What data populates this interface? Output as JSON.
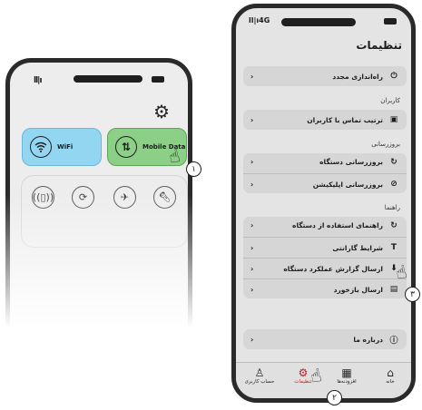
{
  "left_phone": {
    "tiles": {
      "wifi_label": "WiFi",
      "mobile_label": "Mobile Data"
    },
    "quick_buttons": [
      "vibrate-icon",
      "rotate-icon",
      "airplane-icon",
      "flashlight-icon"
    ]
  },
  "right_phone": {
    "network_label": "4G",
    "title": "تنظیمات",
    "rows": {
      "reboot": "راه‌اندازی مجدد",
      "contacts": "ترتیب تماس با کاربران",
      "device_update": "بروزرسانی دستگاه",
      "app_update": "بروزرسانی اپلیکیشن",
      "device_guide": "راهنمای استفاده از دستگاه",
      "warranty": "شرایط گارانتی",
      "report": "ارسال گزارش عملکرد دستگاه",
      "feedback": "ارسال بازخورد",
      "about": "درباره ما"
    },
    "sections": {
      "users": "کاربران",
      "update": "بروزرسانی",
      "guide": "راهنما"
    },
    "nav": {
      "account": "حساب کاربری",
      "settings": "تنظیمات",
      "addons": "افزودنه‌ها",
      "home": "خانه"
    }
  },
  "steps": {
    "one": "۱",
    "two": "۲",
    "three": "۳"
  }
}
